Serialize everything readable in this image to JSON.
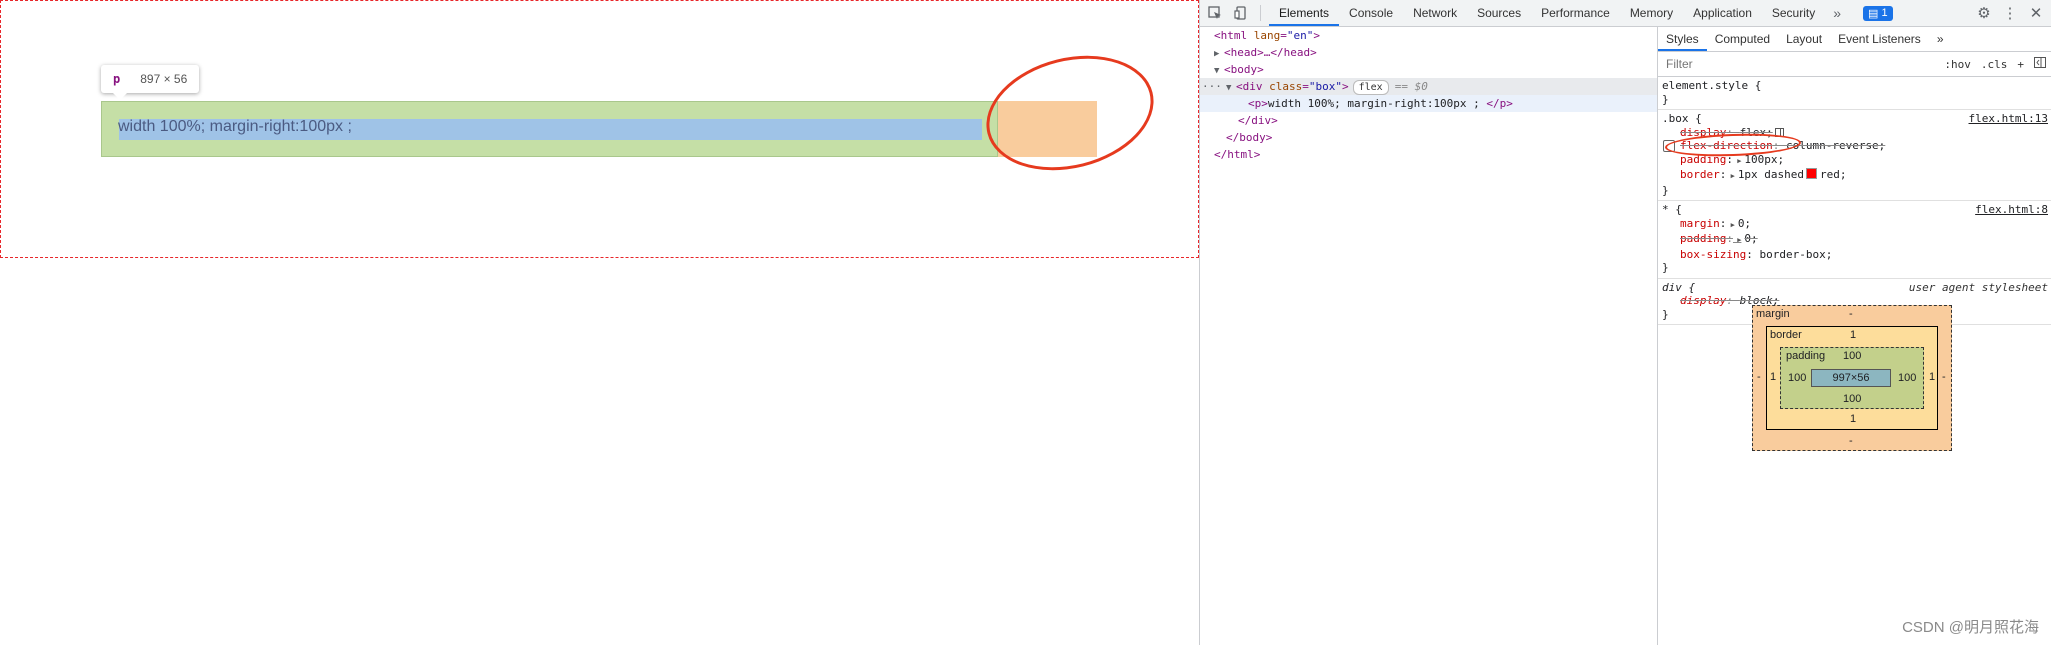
{
  "viewport": {
    "paragraph_text": "width 100%; margin-right:100px ;",
    "tooltip": {
      "tag": "p",
      "dims": "897 × 56"
    }
  },
  "devtools": {
    "tabs": [
      "Elements",
      "Console",
      "Network",
      "Sources",
      "Performance",
      "Memory",
      "Application",
      "Security"
    ],
    "more": "»",
    "badge_count": "1",
    "dom": {
      "html_open_tag": "html",
      "html_attr": "lang",
      "html_val": "\"en\"",
      "head": "<head>…</head>",
      "body_open": "<body>",
      "div_tag": "div",
      "div_attr": "class",
      "div_val": "\"box\"",
      "flex_badge": "flex",
      "eq0": "== $0",
      "p_open": "<p>",
      "p_text": "width 100%; margin-right:100px ; ",
      "p_close": "</p>",
      "div_close": "</div>",
      "body_close": "</body>",
      "html_close": "</html>",
      "dots": "···"
    },
    "styles": {
      "subtabs": [
        "Styles",
        "Computed",
        "Layout",
        "Event Listeners"
      ],
      "subtabs_more": "»",
      "filter_placeholder": "Filter",
      "hov": ":hov",
      "cls": ".cls",
      "plus": "+",
      "element_style": "element.style {",
      "close_brace": "}",
      "box_selector": ".box {",
      "box_src": "flex.html:13",
      "box_decls": [
        {
          "name": "display",
          "value": "flex;"
        },
        {
          "name": "flex-direction",
          "value": "column-reverse;"
        },
        {
          "name": "padding",
          "value": "100px;"
        },
        {
          "name": "border",
          "value": "1px dashed",
          "value2": "red;"
        }
      ],
      "star_selector": "* {",
      "star_src": "flex.html:8",
      "star_decls": [
        {
          "name": "margin",
          "value": "0;"
        },
        {
          "name": "padding",
          "value": "0;"
        },
        {
          "name": "box-sizing",
          "value": "border-box;"
        }
      ],
      "div_selector": "div {",
      "div_src": "user agent stylesheet",
      "div_decls": [
        {
          "name": "display",
          "value": "block;"
        }
      ],
      "colors": {
        "border_swatch": "#ff0000"
      }
    },
    "box_model": {
      "margin_label": "margin",
      "margin_top": "-",
      "margin_bottom": "-",
      "margin_left": "-",
      "margin_right": "-",
      "border_label": "border",
      "border_top": "1",
      "border_bottom": "1",
      "border_left": "1",
      "border_right": "1",
      "padding_label": "padding",
      "padding_top": "100",
      "padding_bottom": "100",
      "padding_left": "100",
      "padding_right": "100",
      "content": "997×56"
    }
  },
  "watermark": "CSDN @明月照花海"
}
